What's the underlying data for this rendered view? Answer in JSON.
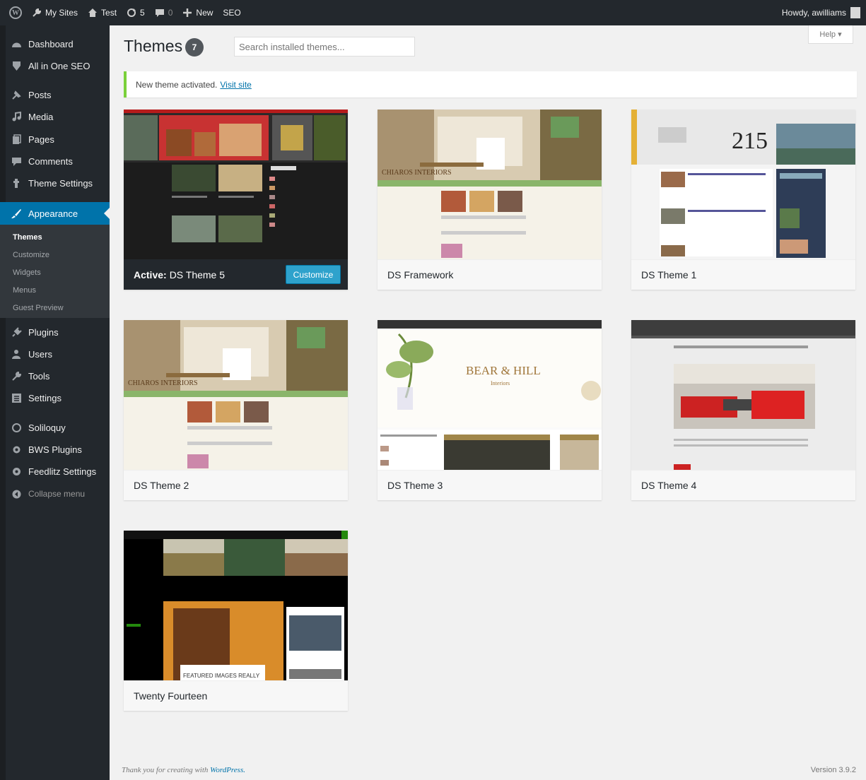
{
  "adminbar": {
    "items": [
      {
        "label": "My Sites",
        "icon": "wrench-icon"
      },
      {
        "label": "Test",
        "icon": "home-icon"
      },
      {
        "label": "5",
        "icon": "updates-icon"
      },
      {
        "label": "0",
        "icon": "comment-icon"
      },
      {
        "label": "New",
        "icon": "plus-icon"
      },
      {
        "label": "SEO",
        "icon": ""
      }
    ],
    "howdy": "Howdy, awilliams"
  },
  "sidebar": {
    "items": [
      {
        "label": "Dashboard",
        "icon": "dashboard-icon"
      },
      {
        "label": "All in One SEO",
        "icon": "seo-icon"
      },
      {
        "label": "Posts",
        "icon": "pin-icon"
      },
      {
        "label": "Media",
        "icon": "media-icon"
      },
      {
        "label": "Pages",
        "icon": "pages-icon"
      },
      {
        "label": "Comments",
        "icon": "comment-icon"
      },
      {
        "label": "Theme Settings",
        "icon": "settings-icon"
      },
      {
        "label": "Appearance",
        "icon": "brush-icon"
      },
      {
        "label": "Plugins",
        "icon": "plugin-icon"
      },
      {
        "label": "Users",
        "icon": "user-icon"
      },
      {
        "label": "Tools",
        "icon": "wrench-icon"
      },
      {
        "label": "Settings",
        "icon": "settings-grid-icon"
      },
      {
        "label": "Soliloquy",
        "icon": "circle-icon"
      },
      {
        "label": "BWS Plugins",
        "icon": "gear-icon"
      },
      {
        "label": "Feedlitz Settings",
        "icon": "gear-icon"
      },
      {
        "label": "Collapse menu",
        "icon": "collapse-icon"
      }
    ],
    "submenu": [
      "Themes",
      "Customize",
      "Widgets",
      "Menus",
      "Guest Preview"
    ]
  },
  "header": {
    "title": "Themes",
    "count": "7",
    "search_placeholder": "Search installed themes...",
    "help": "Help ▾"
  },
  "notice": {
    "text": "New theme activated.",
    "link": "Visit site"
  },
  "themes": [
    {
      "name": "DS Theme 5",
      "active_prefix": "Active:",
      "button": "Customize"
    },
    {
      "name": "DS Framework"
    },
    {
      "name": "DS Theme 1"
    },
    {
      "name": "DS Theme 2"
    },
    {
      "name": "DS Theme 3"
    },
    {
      "name": "DS Theme 4"
    },
    {
      "name": "Twenty Fourteen"
    }
  ],
  "screenshot_text": {
    "chiaros": "CHIAROS INTERIORS",
    "bear_hill": "BEAR & HILL",
    "bear_hill_sub": "Interiors",
    "featured": "FEATURED IMAGES REALLY",
    "theme1_logo": "215"
  },
  "footer": {
    "thanks": "Thank you for creating with",
    "wordpress": "WordPress.",
    "version": "Version 3.9.2"
  },
  "colors": {
    "adminbar": "#23282d",
    "accent": "#0073aa",
    "notice": "#7ad03a"
  }
}
